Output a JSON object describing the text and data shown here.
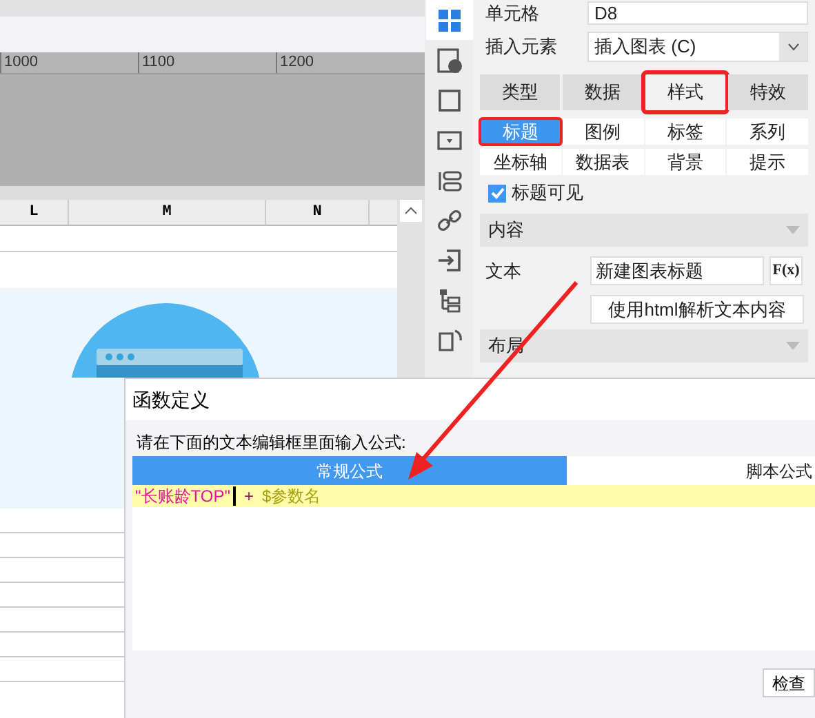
{
  "ruler": {
    "labels": [
      "1000",
      "1100",
      "1200"
    ]
  },
  "sheet": {
    "columns": [
      {
        "label": "L"
      },
      {
        "label": "M"
      },
      {
        "label": "N"
      }
    ]
  },
  "sidebar": {
    "icons": [
      {
        "kind": "grid",
        "selected": true
      },
      {
        "kind": "info",
        "selected": false
      },
      {
        "kind": "square",
        "selected": false
      },
      {
        "kind": "dropdown",
        "selected": false
      },
      {
        "kind": "toggle",
        "selected": false
      },
      {
        "kind": "link",
        "selected": false
      },
      {
        "kind": "import",
        "selected": false
      },
      {
        "kind": "tree",
        "selected": false
      },
      {
        "kind": "refresh",
        "selected": false
      }
    ]
  },
  "panel": {
    "cell": {
      "label": "单元格",
      "value": "D8"
    },
    "insert": {
      "label": "插入元素",
      "value": "插入图表 (C)"
    },
    "tabs": [
      {
        "label": "类型",
        "selected": false
      },
      {
        "label": "数据",
        "selected": false
      },
      {
        "label": "样式",
        "selected": true
      },
      {
        "label": "特效",
        "selected": false
      }
    ],
    "subtabs": [
      {
        "label": "标题",
        "selected": true
      },
      {
        "label": "图例",
        "selected": false
      },
      {
        "label": "标签",
        "selected": false
      },
      {
        "label": "系列",
        "selected": false
      },
      {
        "label": "坐标轴",
        "selected": false
      },
      {
        "label": "数据表",
        "selected": false
      },
      {
        "label": "背景",
        "selected": false
      },
      {
        "label": "提示",
        "selected": false
      }
    ],
    "title_visible": {
      "label": "标题可见",
      "checked": true
    },
    "sections": [
      {
        "label": "内容"
      }
    ],
    "text": {
      "label": "文本",
      "value": "新建图表标题",
      "fx": "F(x)"
    },
    "html_button": "使用html解析文本内容",
    "layout_section": {
      "label": "布局"
    }
  },
  "dialog": {
    "title": "函数定义",
    "prompt": "请在下面的文本编辑框里面输入公式:",
    "tabs": [
      {
        "label": "常规公式",
        "selected": true
      },
      {
        "label": "脚本公式",
        "selected": false
      }
    ],
    "formula": [
      {
        "kind": "string",
        "text": "\"长账龄TOP\""
      },
      {
        "kind": "operator",
        "text": "+"
      },
      {
        "kind": "param",
        "text": "$参数名"
      }
    ],
    "check_button": "检查"
  }
}
